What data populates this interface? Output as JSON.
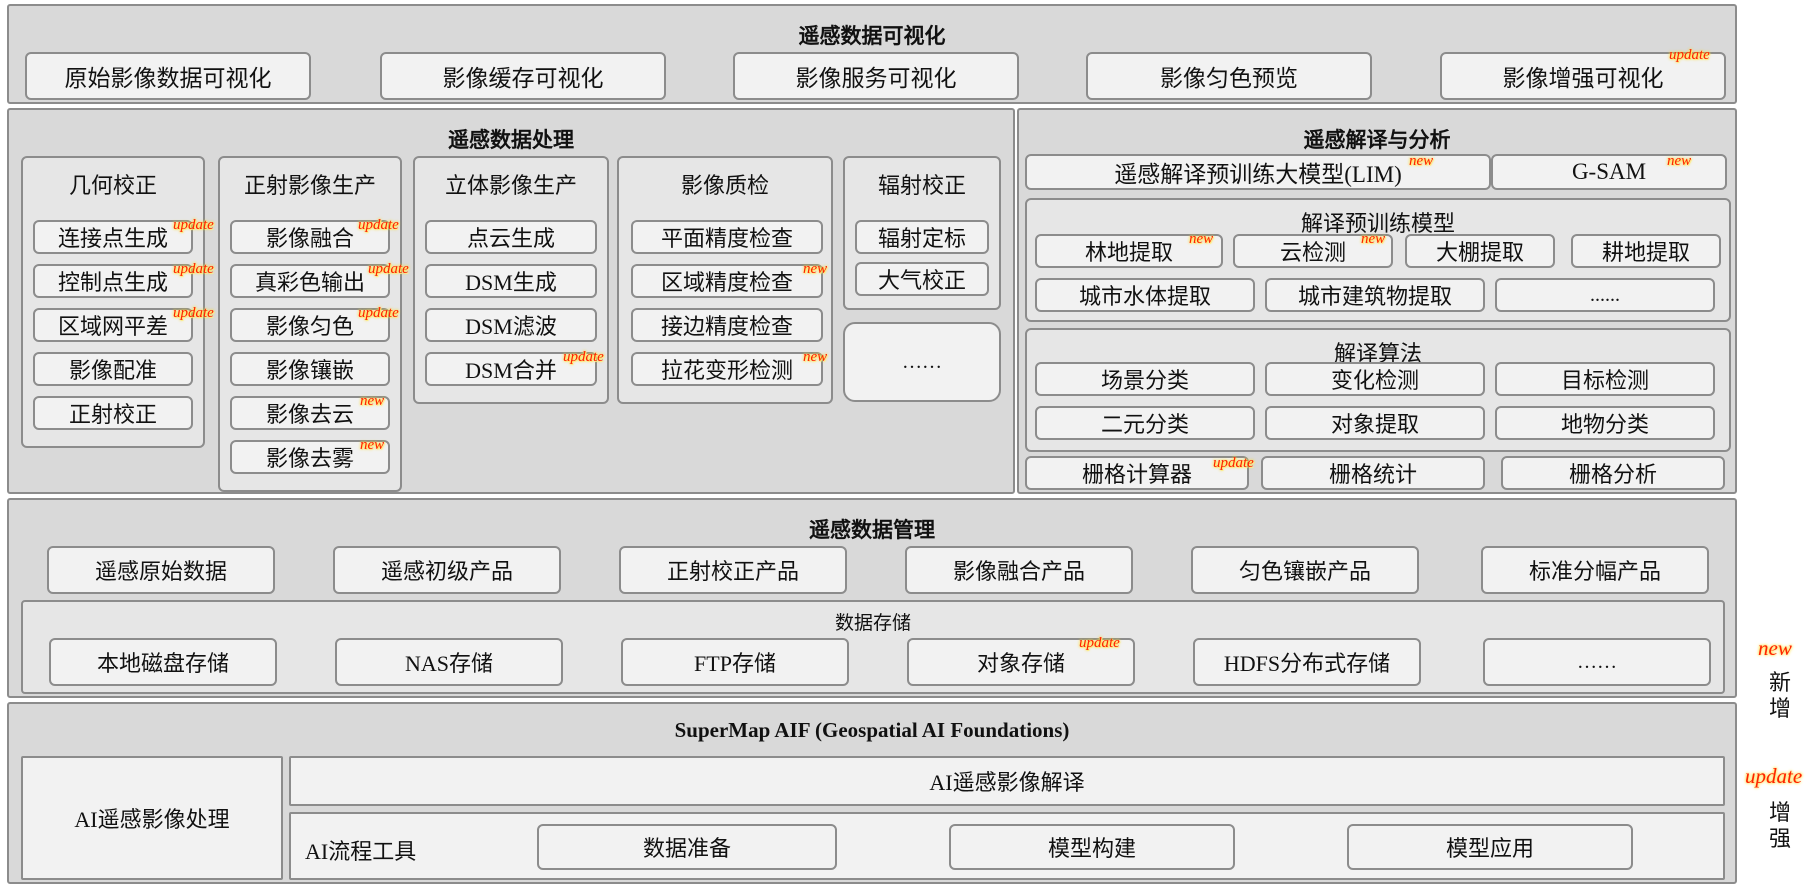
{
  "tags": {
    "new": "new",
    "update": "update"
  },
  "visualization": {
    "title": "遥感数据可视化",
    "items": [
      "原始影像数据可视化",
      "影像缓存可视化",
      "影像服务可视化",
      "影像匀色预览",
      "影像增强可视化"
    ]
  },
  "processing": {
    "title": "遥感数据处理",
    "geometric": {
      "title": "几何校正",
      "items": [
        "连接点生成",
        "控制点生成",
        "区域网平差",
        "影像配准",
        "正射校正"
      ]
    },
    "ortho": {
      "title": "正射影像生产",
      "items": [
        "影像融合",
        "真彩色输出",
        "影像匀色",
        "影像镶嵌",
        "影像去云",
        "影像去雾"
      ]
    },
    "stereo": {
      "title": "立体影像生产",
      "items": [
        "点云生成",
        "DSM生成",
        "DSM滤波",
        "DSM合并"
      ]
    },
    "quality": {
      "title": "影像质检",
      "items": [
        "平面精度检查",
        "区域精度检查",
        "接边精度检查",
        "拉花变形检测"
      ]
    },
    "radiometric": {
      "title": "辐射校正",
      "items": [
        "辐射定标",
        "大气校正"
      ]
    },
    "ellipsis": "……"
  },
  "analysis": {
    "title": "遥感解译与分析",
    "top_items": [
      "遥感解译预训练大模型(LIM)",
      "G-SAM"
    ],
    "pretrained": {
      "title": "解译预训练模型",
      "row1": [
        "林地提取",
        "云检测",
        "大棚提取",
        "耕地提取"
      ],
      "row2": [
        "城市水体提取",
        "城市建筑物提取",
        "......"
      ]
    },
    "algorithms": {
      "title": "解译算法",
      "row1": [
        "场景分类",
        "变化检测",
        "目标检测"
      ],
      "row2": [
        "二元分类",
        "对象提取",
        "地物分类"
      ]
    },
    "raster": [
      "栅格计算器",
      "栅格统计",
      "栅格分析"
    ]
  },
  "management": {
    "title": "遥感数据管理",
    "products": [
      "遥感原始数据",
      "遥感初级产品",
      "正射校正产品",
      "影像融合产品",
      "匀色镶嵌产品",
      "标准分幅产品"
    ],
    "storage": {
      "title": "数据存储",
      "items": [
        "本地磁盘存储",
        "NAS存储",
        "FTP存储",
        "对象存储",
        "HDFS分布式存储",
        "……"
      ]
    }
  },
  "aif": {
    "title": "SuperMap AIF (Geospatial AI Foundations)",
    "processing": "AI遥感影像处理",
    "interpretation": "AI遥感影像解译",
    "workflow": "AI流程工具",
    "steps": [
      "数据准备",
      "模型构建",
      "模型应用"
    ]
  },
  "legend": {
    "new_label": "新增",
    "update_label": "增强"
  }
}
